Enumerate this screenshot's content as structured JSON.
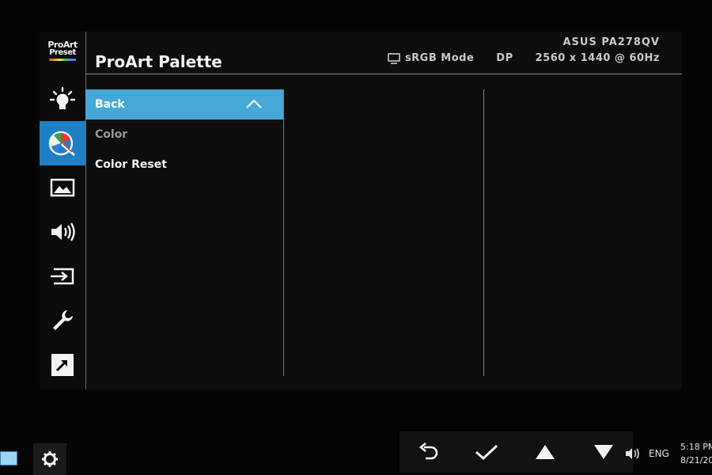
{
  "brand": {
    "logo_line1": "ProArt",
    "logo_line2": "Preset"
  },
  "header": {
    "title": "ProArt Palette",
    "model": "ASUS PA278QV",
    "mode": "sRGB Mode",
    "input": "DP",
    "resolution": "2560 x 1440 @ 60Hz"
  },
  "sidebar": {
    "items": [
      {
        "name": "proart-preset",
        "icon": "proart-preset-logo"
      },
      {
        "name": "blue-light-filter",
        "icon": "lightbulb-icon"
      },
      {
        "name": "proart-palette",
        "icon": "palette-icon",
        "active": true
      },
      {
        "name": "image",
        "icon": "image-icon"
      },
      {
        "name": "sound",
        "icon": "speaker-icon"
      },
      {
        "name": "input-select",
        "icon": "input-icon"
      },
      {
        "name": "system-setup",
        "icon": "wrench-icon"
      },
      {
        "name": "shortcut",
        "icon": "shortcut-arrow-icon"
      }
    ]
  },
  "menu": {
    "items": [
      {
        "label": "Back",
        "selected": true
      },
      {
        "label": "Color"
      },
      {
        "label": "Color Reset"
      }
    ]
  },
  "taskbar": {
    "language": "ENG",
    "time": "5:18 PM",
    "date": "8/21/20"
  },
  "controls": [
    "back-arrow-icon",
    "checkmark-icon",
    "up-triangle-icon",
    "down-triangle-icon"
  ],
  "colors": {
    "accent": "#46a8d6",
    "active_icon_bg": "#1f7fc4",
    "background": "#0d0d0e"
  }
}
